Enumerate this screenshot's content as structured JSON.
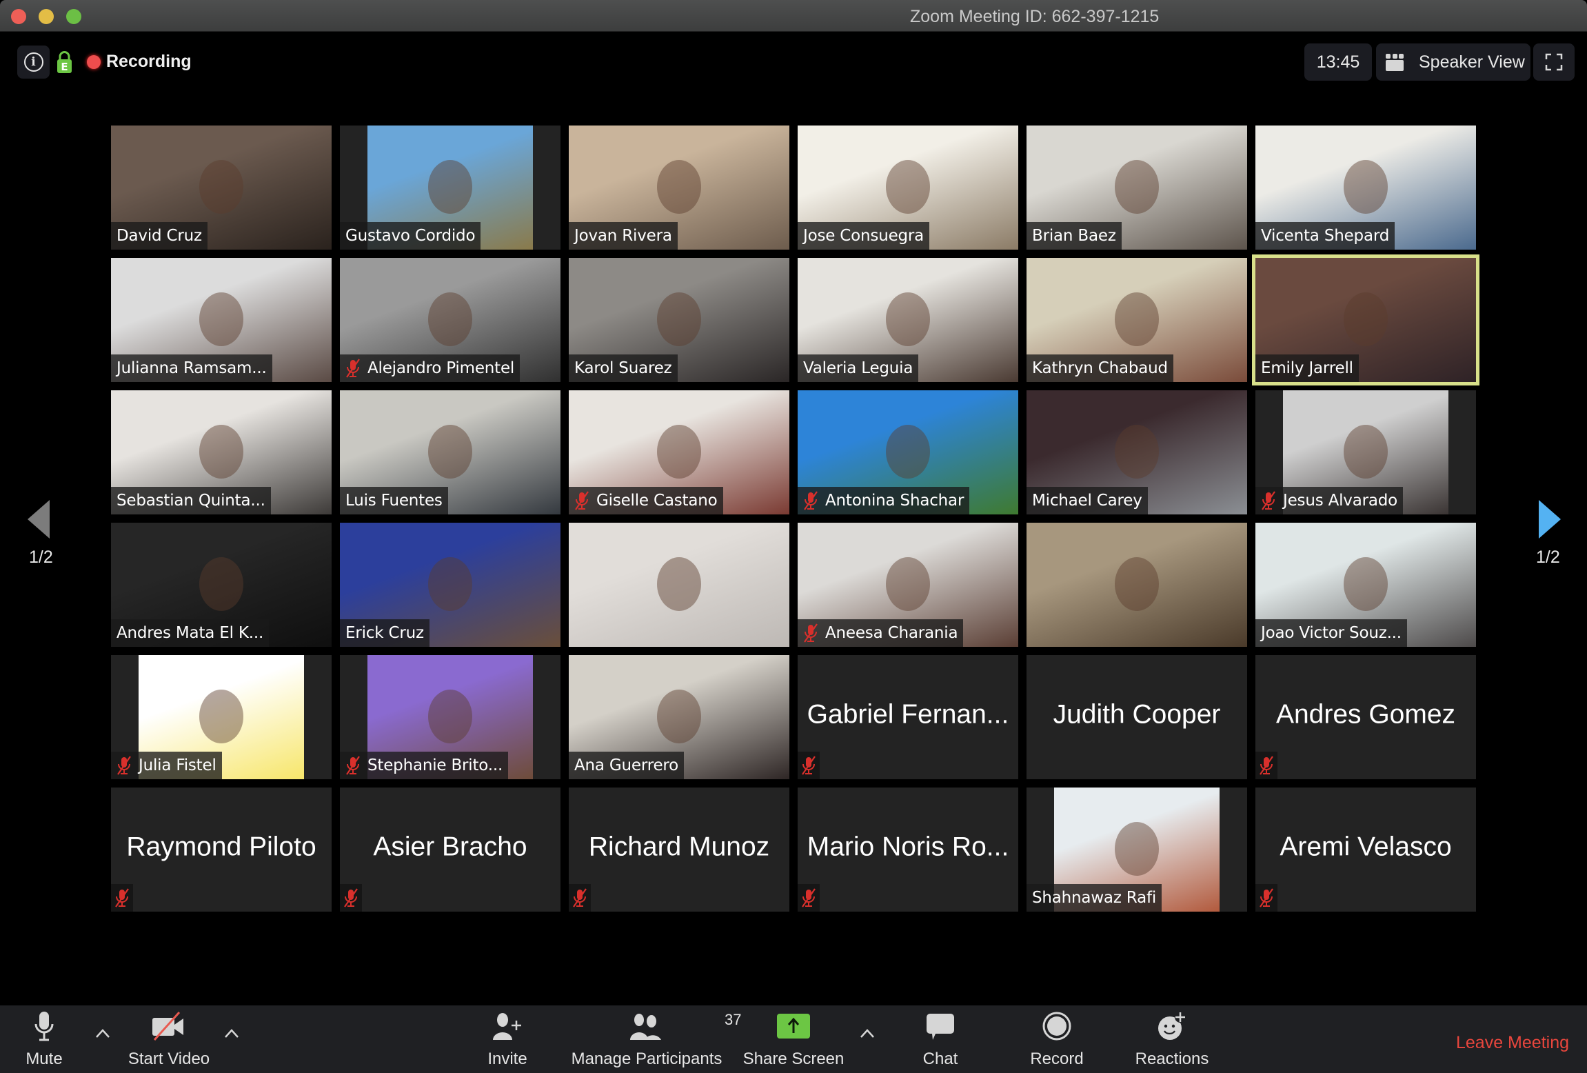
{
  "window": {
    "title": "Zoom Meeting ID: 662-397-1215"
  },
  "topbar": {
    "info_icon": "info-icon",
    "lock_icon": "encryption-lock-icon",
    "lock_letter": "E",
    "recording_label": "Recording",
    "clock": "13:45",
    "speaker_view_label": "Speaker View",
    "fullscreen_icon": "fullscreen-icon"
  },
  "pagination": {
    "prev_label": "1/2",
    "next_label": "1/2"
  },
  "colors": {
    "active_speaker_border": "#d8e08a",
    "muted_icon": "#d9302c",
    "share_screen": "#6cc644",
    "leave_meeting": "#e8463d",
    "next_page_arrow": "#54b2f2",
    "tile_background": "#232323"
  },
  "participants": [
    {
      "name": "David Cruz",
      "video": true,
      "muted": false,
      "bg": [
        "#6b5a4f",
        "#2a221d"
      ]
    },
    {
      "name": "Gustavo Cordido",
      "video": true,
      "pillar": true,
      "muted": false,
      "bg": [
        "#6aa6d8",
        "#8a7a4a"
      ]
    },
    {
      "name": "Jovan Rivera",
      "video": true,
      "muted": false,
      "bg": [
        "#c9b49b",
        "#6d5c4d"
      ]
    },
    {
      "name": "Jose Consuegra",
      "video": true,
      "muted": false,
      "bg": [
        "#f2efe7",
        "#8b7b66"
      ]
    },
    {
      "name": "Brian Baez",
      "video": true,
      "muted": false,
      "bg": [
        "#d9d7d1",
        "#5d544c"
      ]
    },
    {
      "name": "Vicenta Shepard",
      "video": true,
      "muted": false,
      "bg": [
        "#ecebe6",
        "#4b6a8e"
      ]
    },
    {
      "name": "Julianna Ramsam...",
      "video": true,
      "muted": false,
      "bg": [
        "#dcdcdc",
        "#5a4a44"
      ]
    },
    {
      "name": "Alejandro Pimentel",
      "video": true,
      "muted": true,
      "bg": [
        "#9a9a9a",
        "#303030"
      ]
    },
    {
      "name": "Karol Suarez",
      "video": true,
      "muted": false,
      "bg": [
        "#8d8a86",
        "#2a2626"
      ]
    },
    {
      "name": "Valeria Leguia",
      "video": true,
      "muted": false,
      "bg": [
        "#e5e3de",
        "#4a3a32"
      ]
    },
    {
      "name": "Kathryn Chabaud",
      "video": true,
      "muted": false,
      "bg": [
        "#d6cfb9",
        "#7a4b3a"
      ]
    },
    {
      "name": "Emily Jarrell",
      "video": true,
      "muted": false,
      "active": true,
      "bg": [
        "#6a4a3f",
        "#2e2226"
      ]
    },
    {
      "name": "Sebastian Quinta...",
      "video": true,
      "muted": false,
      "bg": [
        "#e6e3df",
        "#3d3a38"
      ]
    },
    {
      "name": "Luis Fuentes",
      "video": true,
      "muted": false,
      "bg": [
        "#c9c8c2",
        "#34393f"
      ]
    },
    {
      "name": "Giselle Castano",
      "video": true,
      "muted": true,
      "bg": [
        "#e8e4df",
        "#7a3a32"
      ]
    },
    {
      "name": "Antonina Shachar",
      "video": true,
      "muted": true,
      "bg": [
        "#2d84d8",
        "#3f7a2f"
      ]
    },
    {
      "name": "Michael Carey",
      "video": true,
      "muted": false,
      "bg": [
        "#3b2a2e",
        "#8b8f94"
      ]
    },
    {
      "name": "Jesus Alvarado",
      "video": true,
      "pillar": true,
      "muted": true,
      "bg": [
        "#cfcfcf",
        "#3a3433"
      ]
    },
    {
      "name": "Andres Mata El K...",
      "video": true,
      "muted": false,
      "bg": [
        "#262626",
        "#0f0f0f"
      ]
    },
    {
      "name": "Erick Cruz",
      "video": true,
      "muted": false,
      "bg": [
        "#2c3f9c",
        "#6a4f3a"
      ]
    },
    {
      "name": "",
      "video": true,
      "muted": false,
      "bg": [
        "#e1ddd9",
        "#bdb8b4"
      ]
    },
    {
      "name": "Aneesa Charania",
      "video": true,
      "muted": true,
      "bg": [
        "#dcdad7",
        "#5a3e34"
      ]
    },
    {
      "name": "",
      "video": true,
      "muted": false,
      "bg": [
        "#a7977e",
        "#4a3a2a"
      ]
    },
    {
      "name": "Joao Victor Souz...",
      "video": true,
      "muted": false,
      "bg": [
        "#dfe6e6",
        "#4d4a4a"
      ]
    },
    {
      "name": "Julia Fistel",
      "video": true,
      "pillar": true,
      "muted": true,
      "bg": [
        "#ffffff",
        "#f7e66a"
      ]
    },
    {
      "name": "Stephanie Brito...",
      "video": true,
      "pillar": true,
      "muted": true,
      "bg": [
        "#8a6ad0",
        "#6e4c39"
      ]
    },
    {
      "name": "Ana Guerrero",
      "video": true,
      "muted": false,
      "bg": [
        "#d4d0c8",
        "#2e2625"
      ]
    },
    {
      "name": "Gabriel Fernan...",
      "video": false,
      "muted": true
    },
    {
      "name": "Judith Cooper",
      "video": false,
      "muted": false
    },
    {
      "name": "Andres Gomez",
      "video": false,
      "muted": true
    },
    {
      "name": "Raymond Piloto",
      "video": false,
      "muted": true
    },
    {
      "name": "Asier Bracho",
      "video": false,
      "muted": true
    },
    {
      "name": "Richard Munoz",
      "video": false,
      "muted": true
    },
    {
      "name": "Mario Noris Ro...",
      "video": false,
      "muted": true
    },
    {
      "name": "Shahnawaz Rafi",
      "video": true,
      "pillar": true,
      "muted": false,
      "bg": [
        "#e7ecef",
        "#b25a3d"
      ]
    },
    {
      "name": "Aremi Velasco",
      "video": false,
      "muted": true
    }
  ],
  "toolbar": {
    "mute": {
      "label": "Mute",
      "icon": "microphone-icon"
    },
    "start_video": {
      "label": "Start Video",
      "icon": "video-off-icon"
    },
    "invite": {
      "label": "Invite",
      "icon": "add-person-icon"
    },
    "participants": {
      "label": "Manage Participants",
      "icon": "participants-icon",
      "count": "37"
    },
    "share_screen": {
      "label": "Share Screen",
      "icon": "share-screen-icon"
    },
    "chat": {
      "label": "Chat",
      "icon": "chat-bubble-icon"
    },
    "record": {
      "label": "Record",
      "icon": "record-icon"
    },
    "reactions": {
      "label": "Reactions",
      "icon": "add-reaction-icon"
    },
    "leave": {
      "label": "Leave Meeting"
    }
  }
}
